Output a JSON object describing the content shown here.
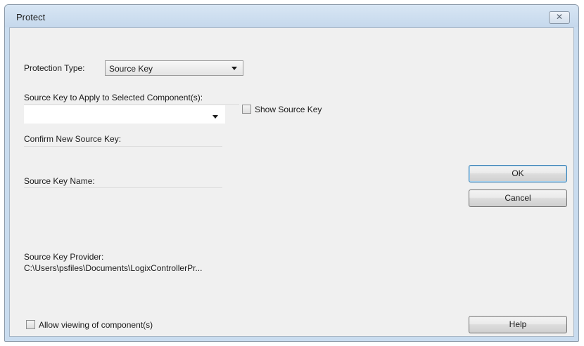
{
  "window": {
    "title": "Protect",
    "close_glyph": "✕"
  },
  "protection": {
    "type_label": "Protection Type:",
    "type_value": "Source Key"
  },
  "source_key": {
    "apply_label": "Source Key to Apply to Selected Component(s):",
    "apply_value": "",
    "show_key_label": "Show Source Key",
    "show_key_checked": false,
    "confirm_label": "Confirm New Source Key:",
    "name_label": "Source Key Name:"
  },
  "provider": {
    "label": "Source Key Provider:",
    "path": "C:\\Users\\psfiles\\Documents\\LogixControllerPr..."
  },
  "allow_viewing": {
    "label": "Allow viewing of component(s)",
    "checked": false
  },
  "buttons": {
    "ok": "OK",
    "cancel": "Cancel",
    "help": "Help"
  }
}
